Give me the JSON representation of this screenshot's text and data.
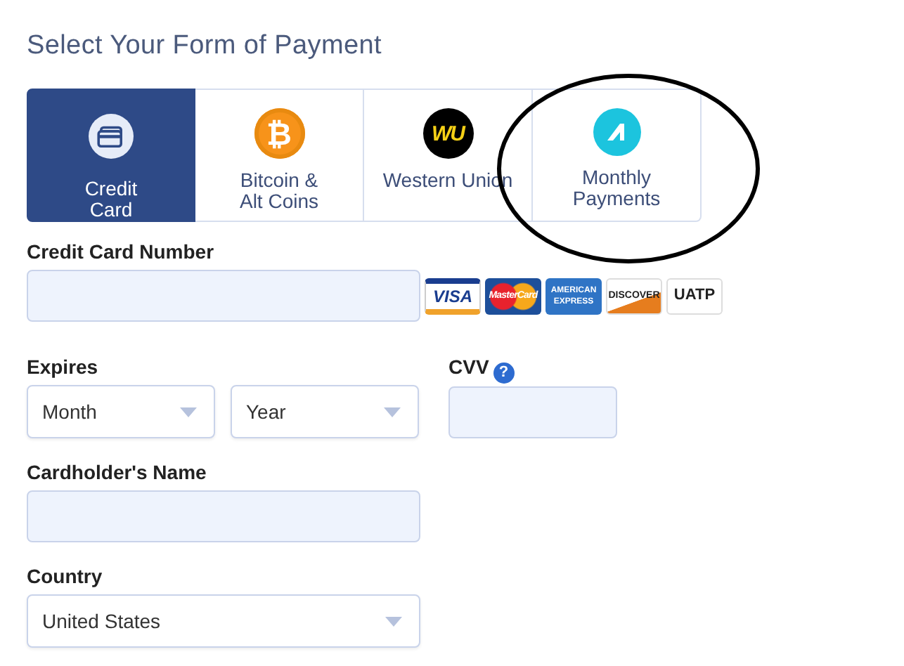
{
  "title": "Select Your Form of Payment",
  "methods": [
    {
      "label": "Credit Card",
      "kind": "card",
      "selected": true
    },
    {
      "label": "Bitcoin & Alt Coins",
      "kind": "bitcoin",
      "icon_text": "₿",
      "selected": false
    },
    {
      "label": "Western Union",
      "kind": "wu",
      "icon_text": "WU",
      "selected": false
    },
    {
      "label": "Monthly Payments",
      "kind": "monthly",
      "selected": false
    }
  ],
  "annotations": [
    {
      "kind": "ellipse"
    }
  ],
  "card_number": {
    "label": "Credit Card Number"
  },
  "card_logos": [
    {
      "label": "VISA",
      "kind": "visa"
    },
    {
      "label": "MasterCard",
      "kind": "mastercard"
    },
    {
      "label": "AMERICAN EXPRESS",
      "kind": "amex"
    },
    {
      "label": "DISCOVER",
      "kind": "discover"
    },
    {
      "label": "UATP",
      "kind": "uatp"
    }
  ],
  "expires": {
    "label": "Expires",
    "month": "Month",
    "year": "Year"
  },
  "cvv": {
    "label": "CVV",
    "help_icon": "?"
  },
  "cardholder": {
    "label": "Cardholder's Name"
  },
  "country": {
    "label": "Country",
    "value": "United States"
  }
}
